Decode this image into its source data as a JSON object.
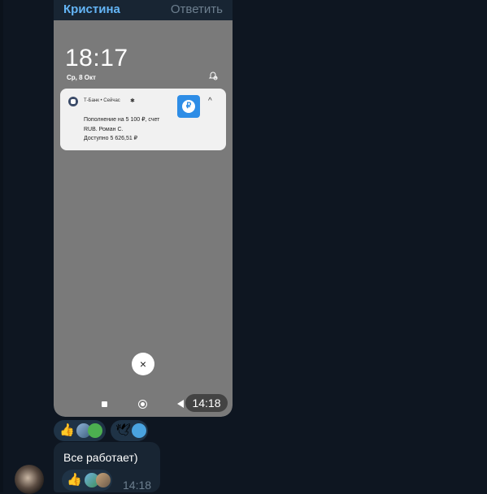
{
  "reply": {
    "name": "Кристина",
    "action_label": "Ответить"
  },
  "screenshot": {
    "lock_time": "18:17",
    "lock_date": "Ср, 8 Окт",
    "notification": {
      "app_line": "Т-Банк • Сейчас",
      "bell": "✱",
      "line1": "Пополнение на 5 100 ₽, счет",
      "line2": "RUB. Роман С.",
      "line3": "Доступно 5 626,51 ₽",
      "thumb_glyph": "₽",
      "chevron": "^"
    },
    "dismiss_glyph": "×"
  },
  "photo_message": {
    "time": "14:18"
  },
  "reactions_row1": {
    "thumbs": "👍",
    "dove": "🕊"
  },
  "text_message": {
    "text": "Все работает)",
    "time": "14:18",
    "thumbs": "👍"
  },
  "colors": {
    "background": "#0e1621",
    "bubble": "#182533",
    "accent": "#64b5f6",
    "reaction_chip": "#1f3346"
  }
}
